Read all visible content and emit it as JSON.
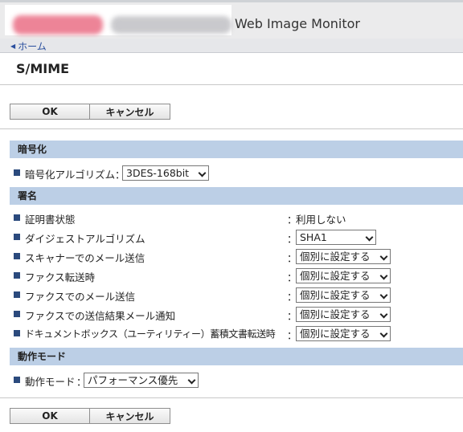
{
  "header": {
    "app_title": "Web Image Monitor"
  },
  "breadcrumb": {
    "home": "ホーム"
  },
  "page": {
    "title": "S/MIME"
  },
  "buttons": {
    "ok": "OK",
    "cancel": "キャンセル"
  },
  "sections": {
    "encryption": {
      "title": "暗号化",
      "rows": [
        {
          "label": "暗号化アルゴリズム",
          "value": "3DES-168bit"
        }
      ]
    },
    "signature": {
      "title": "署名",
      "rows": [
        {
          "label": "証明書状態",
          "value": "利用しない"
        },
        {
          "label": "ダイジェストアルゴリズム",
          "value": "SHA1"
        },
        {
          "label": "スキャナーでのメール送信",
          "value": "個別に設定する"
        },
        {
          "label": "ファクス転送時",
          "value": "個別に設定する"
        },
        {
          "label": "ファクスでのメール送信",
          "value": "個別に設定する"
        },
        {
          "label": "ファクスでの送信結果メール通知",
          "value": "個別に設定する"
        },
        {
          "label": "ドキュメントボックス（ユーティリティー）蓄積文書転送時",
          "value": "個別に設定する"
        }
      ]
    },
    "mode": {
      "title": "動作モード",
      "rows": [
        {
          "label": "動作モード",
          "value": "パフォーマンス優先"
        }
      ]
    }
  },
  "colon": "：",
  "colors": {
    "section_bg": "#bccfe6",
    "bullet": "#2b4a7d",
    "link": "#2a4f9e"
  }
}
